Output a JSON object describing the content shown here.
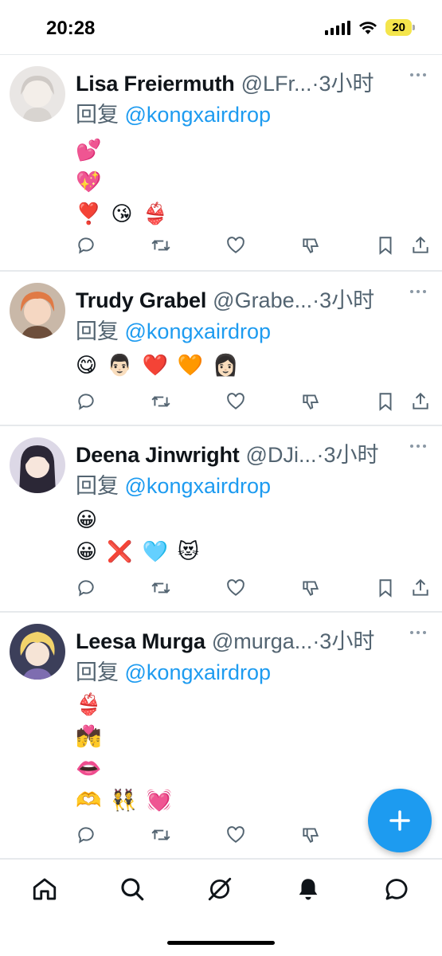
{
  "status_bar": {
    "time": "20:28",
    "battery": "20",
    "icons": [
      "signal-icon",
      "wifi-icon",
      "battery-icon"
    ]
  },
  "tweets": [
    {
      "name": "Lisa Freiermuth",
      "handle": "@LFr...",
      "time": "·3小时",
      "reply_prefix": "回复 ",
      "reply_mention": "@kongxairdrop",
      "emoji_lines": [
        [
          "💕"
        ],
        [
          "💖"
        ],
        [
          "❣️",
          "😘",
          "👙"
        ]
      ]
    },
    {
      "name": "Trudy Grabel",
      "handle": "@Grabe...",
      "time": "·3小时",
      "reply_prefix": "回复 ",
      "reply_mention": "@kongxairdrop",
      "emoji_lines": [
        [
          "😋",
          "👨🏻",
          "❤️",
          "🧡",
          "👩🏻"
        ]
      ]
    },
    {
      "name": "Deena Jinwright",
      "handle": "@DJi...",
      "time": "·3小时",
      "reply_prefix": "回复 ",
      "reply_mention": "@kongxairdrop",
      "emoji_lines": [
        [
          "😀"
        ],
        [
          "😀",
          "❌",
          "🩵",
          "😻"
        ]
      ]
    },
    {
      "name": "Leesa Murga",
      "handle": "@murga...",
      "time": "·3小时",
      "reply_prefix": "回复 ",
      "reply_mention": "@kongxairdrop",
      "emoji_lines": [
        [
          "👙"
        ],
        [
          "💏"
        ],
        [
          "👄"
        ],
        [
          "🫶",
          "👯",
          "💓"
        ]
      ]
    }
  ],
  "tweet_actions": [
    "reply-icon",
    "retweet-icon",
    "like-icon",
    "dislike-icon",
    "bookmark-icon",
    "share-icon"
  ],
  "tab_bar": [
    "home-icon",
    "search-icon",
    "grok-icon",
    "notifications-icon",
    "messages-icon"
  ],
  "colors": {
    "accent": "#1d9bf0",
    "text": "#0f1419",
    "secondary": "#536471",
    "divider": "#e6e9ec"
  }
}
